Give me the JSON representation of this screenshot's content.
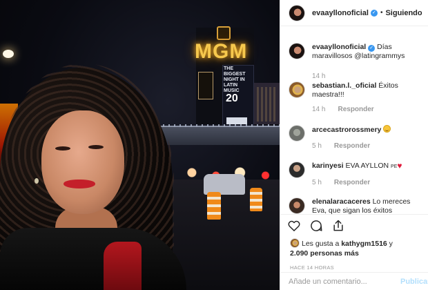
{
  "photo": {
    "sign_main": "MGM",
    "sign_screen_text": "THE BIGGEST NIGHT IN LATIN MUSIC",
    "sign_number": "20"
  },
  "header": {
    "username": "evaayllonoficial",
    "verified_mark": "✓",
    "separator": "•",
    "follow_status": "Siguiendo"
  },
  "comments": [
    {
      "user": "evaayllonoficial",
      "verified": true,
      "text": "Días maravillosos @latingrammys",
      "time": "14 h",
      "reply": ""
    },
    {
      "user": "sebastian.l._oficial",
      "text": "Éxitos maestra!!!",
      "time": "14 h",
      "reply": "Responder"
    },
    {
      "user": "arcecastrorossmery",
      "text": "",
      "time": "5 h",
      "reply": "Responder",
      "emoji": "smile"
    },
    {
      "user": "karinyesi",
      "text": "EVA AYLLON",
      "suffix": "PE",
      "time": "5 h",
      "reply": "Responder",
      "emoji": "heart"
    },
    {
      "user": "elenalaracaceres",
      "text": "Lo mereces Eva, que sigan los éxitos",
      "time": "",
      "reply": ""
    }
  ],
  "actions": {
    "icons": [
      "heart-icon",
      "comment-icon",
      "share-icon"
    ],
    "likes_prefix": "Les gusta a ",
    "likes_user": "kathygm1516",
    "likes_mid": " y ",
    "likes_count": "2.090 personas más",
    "time_ago": "HACE 14 HORAS"
  },
  "add_comment": {
    "placeholder": "Añade un comentario...",
    "publish_label": "Publicar"
  },
  "colors": {
    "verified": "#3897f0",
    "link_disabled": "#b2dffc",
    "meta_gray": "#999999"
  }
}
